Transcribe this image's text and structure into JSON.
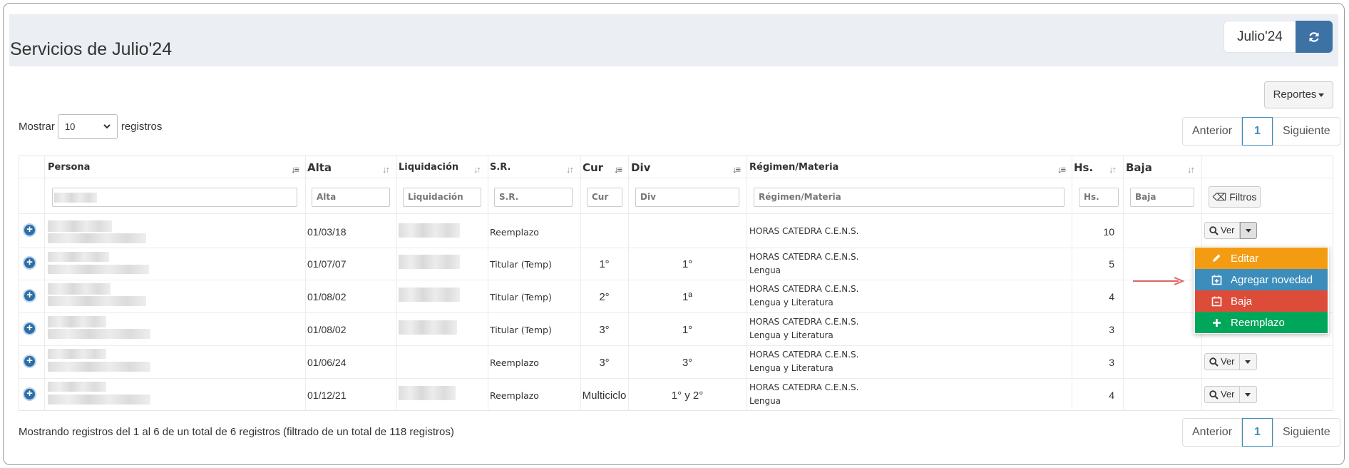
{
  "header": {
    "title": "Servicios de Julio'24",
    "period": "Julio'24",
    "refresh_icon": "refresh-icon"
  },
  "toolbar": {
    "reportes_label": "Reportes"
  },
  "length": {
    "prefix": "Mostrar",
    "value": "10",
    "suffix": "registros"
  },
  "pagination": {
    "prev": "Anterior",
    "page": "1",
    "next": "Siguiente"
  },
  "table": {
    "columns": {
      "persona": "Persona",
      "alta": "Alta",
      "liquidacion": "Liquidación",
      "sr": "S.R.",
      "cur": "Cur",
      "div": "Div",
      "regimen": "Régimen/Materia",
      "hs": "Hs.",
      "baja": "Baja"
    },
    "filters": {
      "alta": "Alta",
      "liquidacion": "Liquidación",
      "sr": "S.R.",
      "cur": "Cur",
      "div": "Div",
      "regimen": "Régimen/Materia",
      "hs": "Hs.",
      "baja": "Baja",
      "filtros_label": "Filtros"
    },
    "ver_label": "Ver",
    "rows": [
      {
        "alta": "01/03/18",
        "sr": "Reemplazo",
        "cur": "",
        "div": "",
        "regimen": "HORAS CATEDRA C.E.N.S.",
        "materia": "",
        "hs": "10",
        "baja": ""
      },
      {
        "alta": "01/07/07",
        "sr": "Titular (Temp)",
        "cur": "1°",
        "div": "1°",
        "regimen": "HORAS CATEDRA C.E.N.S.",
        "materia": "Lengua",
        "hs": "5",
        "baja": ""
      },
      {
        "alta": "01/08/02",
        "sr": "Titular (Temp)",
        "cur": "2°",
        "div": "1ª",
        "regimen": "HORAS CATEDRA C.E.N.S.",
        "materia": "Lengua y Literatura",
        "hs": "4",
        "baja": ""
      },
      {
        "alta": "01/08/02",
        "sr": "Titular (Temp)",
        "cur": "3°",
        "div": "1°",
        "regimen": "HORAS CATEDRA C.E.N.S.",
        "materia": "Lengua y Literatura",
        "hs": "3",
        "baja": ""
      },
      {
        "alta": "01/06/24",
        "sr": "Reemplazo",
        "cur": "3°",
        "div": "3°",
        "regimen": "HORAS CATEDRA C.E.N.S.",
        "materia": "Lengua y Literatura",
        "hs": "3",
        "baja": ""
      },
      {
        "alta": "01/12/21",
        "sr": "Reemplazo",
        "cur": "Multiciclo",
        "div": "1° y 2°",
        "regimen": "HORAS CATEDRA C.E.N.S.",
        "materia": "Lengua",
        "hs": "4",
        "baja": ""
      }
    ]
  },
  "dropdown": {
    "items": [
      {
        "label": "Editar",
        "color": "#f39c12",
        "icon": "pencil-icon"
      },
      {
        "label": "Agregar novedad",
        "color": "#3c8dbc",
        "icon": "calendar-plus-icon"
      },
      {
        "label": "Baja",
        "color": "#dd4b39",
        "icon": "calendar-minus-icon"
      },
      {
        "label": "Reemplazo",
        "color": "#00a65a",
        "icon": "plus-icon"
      }
    ]
  },
  "footer": {
    "info": "Mostrando registros del 1 al 6 de un total de 6 registros (filtrado de un total de 118 registros)"
  },
  "colors": {
    "primary": "#3c72a4",
    "header_bg": "#ebeef3",
    "link": "#3c8dbc"
  }
}
